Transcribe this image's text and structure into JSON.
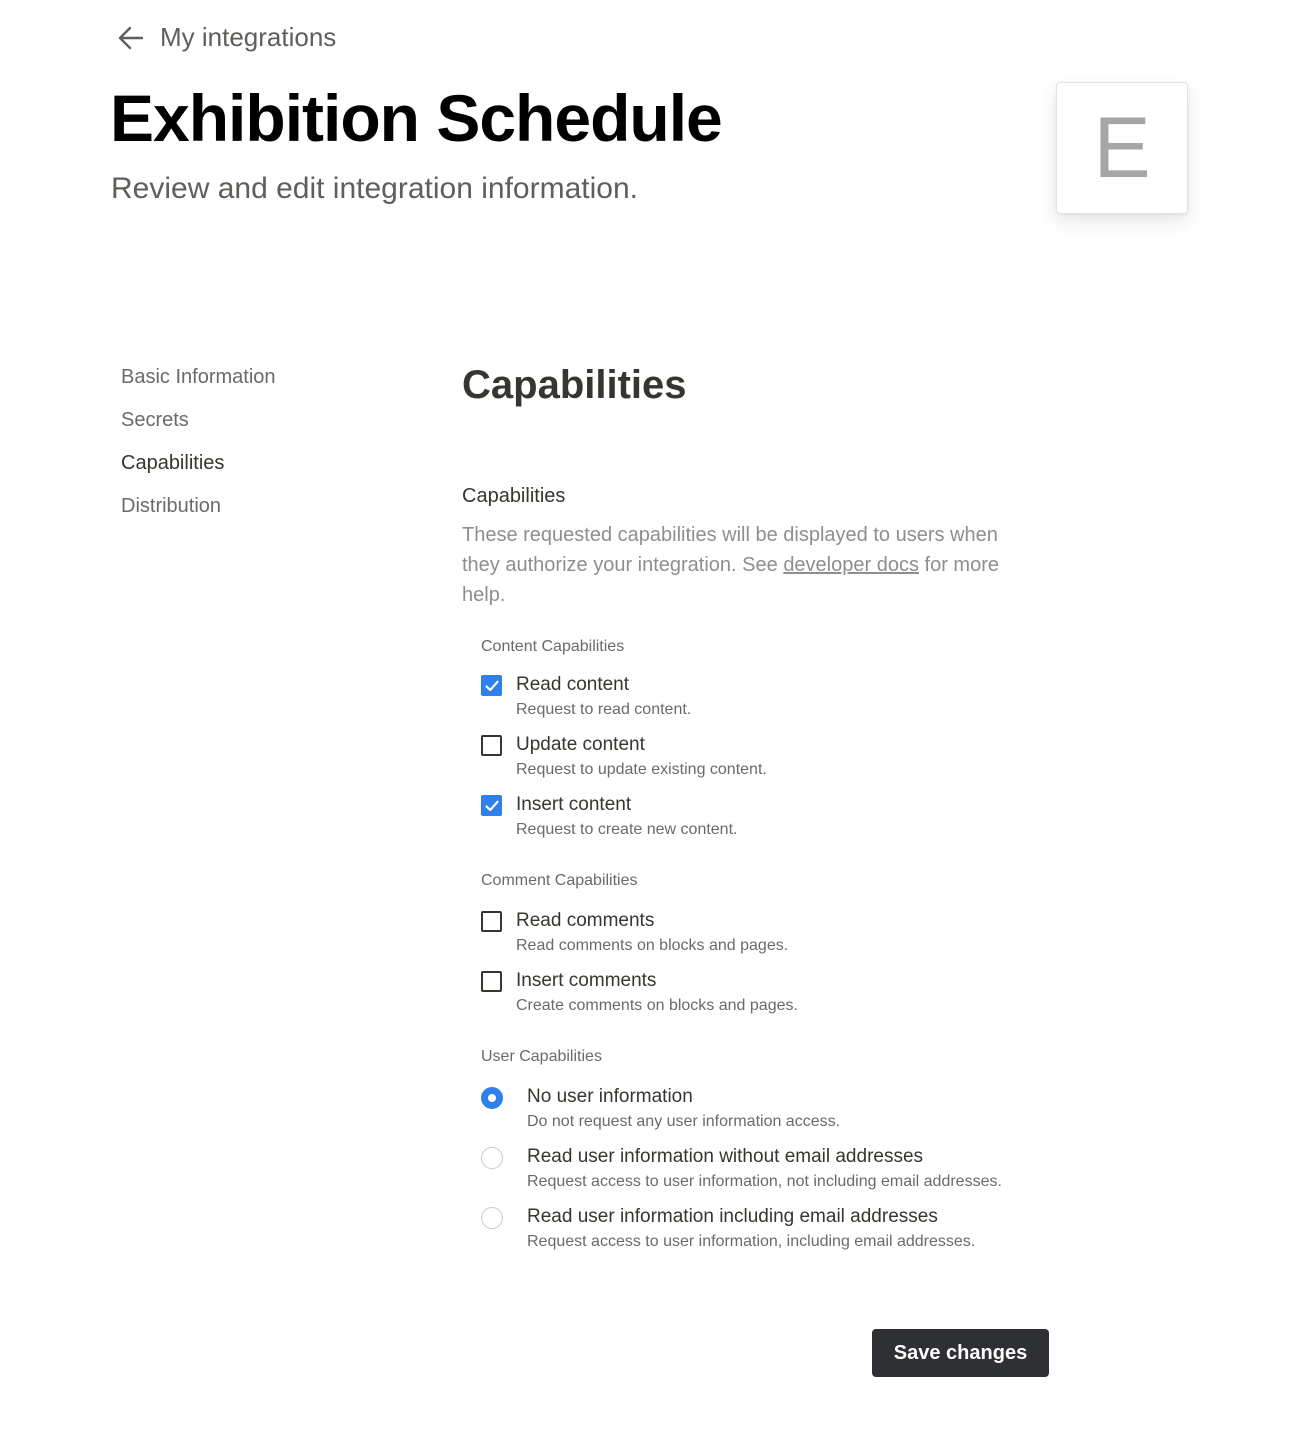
{
  "header": {
    "back_label": "My integrations",
    "title": "Exhibition Schedule",
    "subtitle": "Review and edit integration information.",
    "avatar_letter": "E"
  },
  "sidenav": {
    "items": [
      {
        "label": "Basic Information",
        "active": false
      },
      {
        "label": "Secrets",
        "active": false
      },
      {
        "label": "Capabilities",
        "active": true
      },
      {
        "label": "Distribution",
        "active": false
      }
    ]
  },
  "main": {
    "section_title": "Capabilities",
    "block_label": "Capabilities",
    "desc_before": "These requested capabilities will be displayed to users when they authorize your integration. See ",
    "desc_link": "developer docs",
    "desc_after": " for more help.",
    "content_group": {
      "label": "Content Capabilities",
      "options": [
        {
          "title": "Read content",
          "desc": "Request to read content.",
          "checked": true
        },
        {
          "title": "Update content",
          "desc": "Request to update existing content.",
          "checked": false
        },
        {
          "title": "Insert content",
          "desc": "Request to create new content.",
          "checked": true
        }
      ]
    },
    "comment_group": {
      "label": "Comment Capabilities",
      "options": [
        {
          "title": "Read comments",
          "desc": "Read comments on blocks and pages.",
          "checked": false
        },
        {
          "title": "Insert comments",
          "desc": "Create comments on blocks and pages.",
          "checked": false
        }
      ]
    },
    "user_group": {
      "label": "User Capabilities",
      "options": [
        {
          "title": "No user information",
          "desc": "Do not request any user information access.",
          "selected": true
        },
        {
          "title": "Read user information without email addresses",
          "desc": "Request access to user information, not including email addresses.",
          "selected": false
        },
        {
          "title": "Read user information including email addresses",
          "desc": "Request access to user information, including email addresses.",
          "selected": false
        }
      ]
    },
    "save_label": "Save changes"
  },
  "colors": {
    "accent": "#2f80ed",
    "button_bg": "#2f3033",
    "text": "#37352f",
    "muted": "#6b6a67"
  }
}
